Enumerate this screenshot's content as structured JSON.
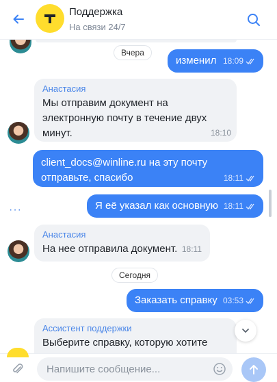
{
  "header": {
    "title": "Поддержка",
    "subtitle": "На связи 24/7",
    "back_icon": "arrow-left-icon",
    "logo_icon": "t-logo-icon",
    "search_icon": "search-icon"
  },
  "messages": {
    "date_yesterday": "Вчера",
    "out_1": {
      "text": "изменил",
      "time": "18:09"
    },
    "in_1": {
      "sender": "Анастасия",
      "lines": [
        "Мы отправим документ на",
        "электронную почту в течение двух",
        "минут."
      ],
      "time": "18:10"
    },
    "out_2": {
      "line1": "client_docs@winline.ru на эту почту",
      "line2": "отправьте, спасибо",
      "time": "18:11"
    },
    "out_3": {
      "text": "Я её указал как основную",
      "time": "18:11"
    },
    "in_2": {
      "sender": "Анастасия",
      "text": "На нее отправила документ.",
      "time": "18:11"
    },
    "date_today": "Сегодня",
    "out_4": {
      "text": "Заказать справку",
      "time": "03:53"
    },
    "in_3": {
      "sender": "Ассистент поддержки",
      "text": "Выберите справку, которую хотите"
    }
  },
  "more_options": "···",
  "input": {
    "placeholder": "Напишите сообщение...",
    "value": ""
  },
  "colors": {
    "accent": "#3b82f6",
    "incoming_bubble": "#f0f2f5",
    "brand_yellow": "#ffdd2d",
    "sender_name": "#4a86e8"
  }
}
